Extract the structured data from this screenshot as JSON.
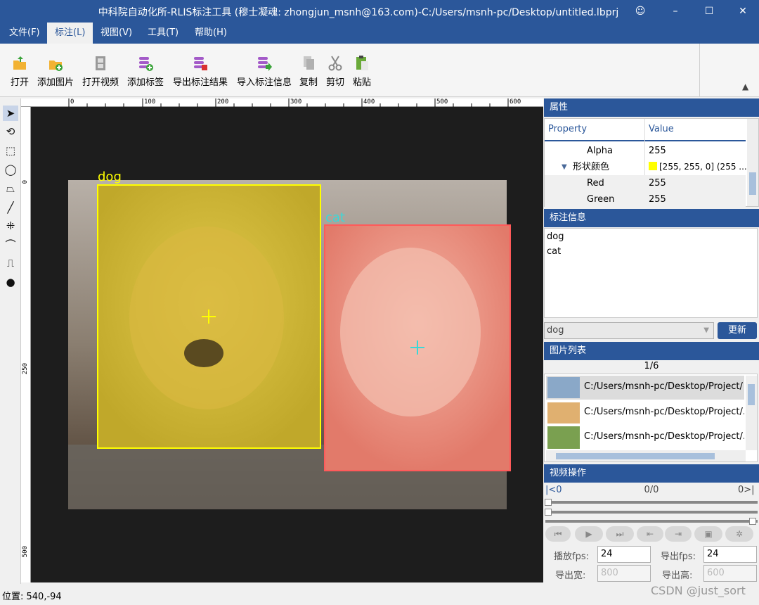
{
  "window": {
    "title": "中科院自动化所-RLIS标注工具 (穆士凝魂: zhongjun_msnh@163.com)-C:/Users/msnh-pc/Desktop/untitled.lbprj",
    "controls": {
      "emoji": "☺",
      "minimize": "–",
      "maximize": "☐",
      "close": "✕"
    }
  },
  "menu": [
    "文件(F)",
    "标注(L)",
    "视图(V)",
    "工具(T)",
    "帮助(H)"
  ],
  "toolbar": [
    "打开",
    "添加图片",
    "打开视频",
    "添加标签",
    "导出标注结果",
    "导入标注信息",
    "复制",
    "剪切",
    "粘贴"
  ],
  "ruler": {
    "top": [
      "0",
      "100",
      "200",
      "300",
      "400",
      "500",
      "600"
    ],
    "left": [
      "0",
      "250",
      "500"
    ]
  },
  "annotations": [
    {
      "label": "dog",
      "color": "#ffff00"
    },
    {
      "label": "cat",
      "color": "#ff5a5a"
    }
  ],
  "properties": {
    "title": "属性",
    "header_property": "Property",
    "header_value": "Value",
    "rows": [
      {
        "name": "Alpha",
        "value": "255"
      },
      {
        "name": "形状颜色",
        "value": "[255, 255, 0] (255 ..."
      },
      {
        "name": "Red",
        "value": "255"
      },
      {
        "name": "Green",
        "value": "255"
      }
    ]
  },
  "annotation_info": {
    "title": "标注信息",
    "items": [
      "dog",
      "cat"
    ],
    "selected": "dog",
    "update_button": "更新"
  },
  "image_list": {
    "title": "图片列表",
    "counter": "1/6",
    "items": [
      "C:/Users/msnh-pc/Desktop/Project/",
      "C:/Users/msnh-pc/Desktop/Project/.",
      "C:/Users/msnh-pc/Desktop/Project/."
    ]
  },
  "video": {
    "title": "视频操作",
    "start_marker": "|<0",
    "frame": "0/0",
    "end_marker": "0>|",
    "play_fps_label": "播放fps:",
    "play_fps": "24",
    "export_fps_label": "导出fps:",
    "export_fps": "24",
    "export_width_label": "导出宽:",
    "export_width": "800",
    "export_height_label": "导出高:",
    "export_height": "600"
  },
  "status": {
    "position": "位置: 540,-94"
  },
  "watermark": "CSDN @just_sort"
}
